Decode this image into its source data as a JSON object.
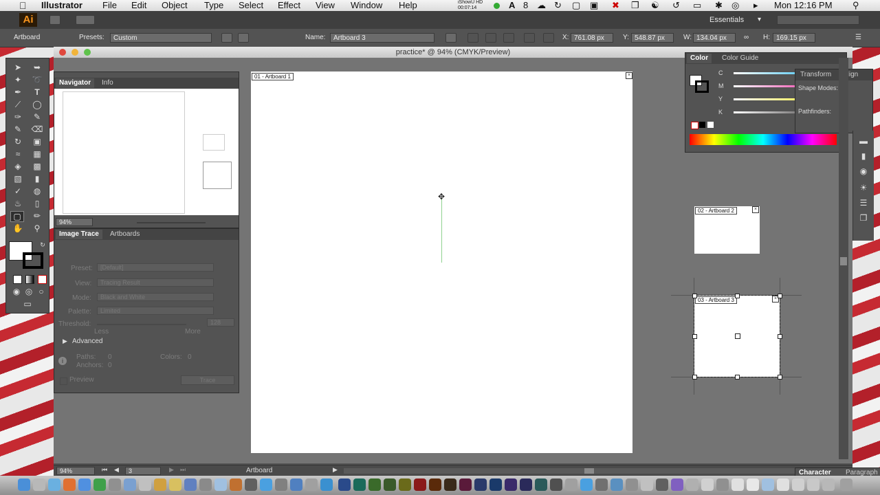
{
  "menubar": {
    "apple": "",
    "app_name": "Illustrator",
    "items": [
      "File",
      "Edit",
      "Object",
      "Type",
      "Select",
      "Effect",
      "View",
      "Window",
      "Help"
    ],
    "recorder_label": "iShowU HD",
    "recorder_time": "00:07:14",
    "adobe_count": "8",
    "clock": "Mon 12:16 PM"
  },
  "appbar": {
    "logo": "Ai",
    "workspace": "Essentials",
    "workspace_arrow": "▾",
    "search_placeholder": ""
  },
  "controlbar": {
    "tool_label": "Artboard",
    "presets_label": "Presets:",
    "presets_value": "Custom",
    "name_label": "Name:",
    "name_value": "Artboard 3",
    "x_label": "X:",
    "x_value": "761.08 px",
    "y_label": "Y:",
    "y_value": "548.87 px",
    "w_label": "W:",
    "w_value": "134.04 px",
    "h_label": "H:",
    "h_value": "169.15 px"
  },
  "document": {
    "title": "practice* @ 94% (CMYK/Preview)"
  },
  "navigator": {
    "tabs": [
      "Navigator",
      "Info"
    ],
    "zoom": "94%"
  },
  "image_trace": {
    "tabs": [
      "Image Trace",
      "Artboards"
    ],
    "preset_label": "Preset:",
    "preset_value": "[Default]",
    "view_label": "View:",
    "view_value": "Tracing Result",
    "mode_label": "Mode:",
    "mode_value": "Black and White",
    "palette_label": "Palette:",
    "palette_value": "Limited",
    "threshold_label": "Threshold:",
    "threshold_value": "128",
    "less": "Less",
    "more": "More",
    "advanced": "Advanced",
    "paths_label": "Paths:",
    "paths_value": "0",
    "colors_label": "Colors:",
    "colors_value": "0",
    "anchors_label": "Anchors:",
    "anchors_value": "0",
    "preview_label": "Preview",
    "trace_button": "Trace"
  },
  "color_panel": {
    "tabs": [
      "Color",
      "Color Guide"
    ],
    "channels": [
      "C",
      "M",
      "Y",
      "K"
    ],
    "channel_colors": [
      "#00aeef",
      "#ec008c",
      "#fff200",
      "#231f20"
    ]
  },
  "transform_panel": {
    "tabs": [
      "Transform",
      "Align"
    ],
    "shape_modes": "Shape Modes:",
    "pathfinders": "Pathfinders:"
  },
  "artboards": {
    "ab1_label": "01 - Artboard 1",
    "ab2_label": "02 - Artboard 2",
    "ab3_label": "03 - Artboard 3"
  },
  "statusbar": {
    "zoom": "94%",
    "artboard_number": "3",
    "status_text": "Artboard"
  },
  "character_panel": {
    "tabs": [
      "Character",
      "Paragraph"
    ]
  },
  "colors": {
    "menubar_bg": "#e2e2e2",
    "ui_dark": "#535353",
    "accent_orange": "#f7941d",
    "selection_green": "#8fd18f"
  }
}
